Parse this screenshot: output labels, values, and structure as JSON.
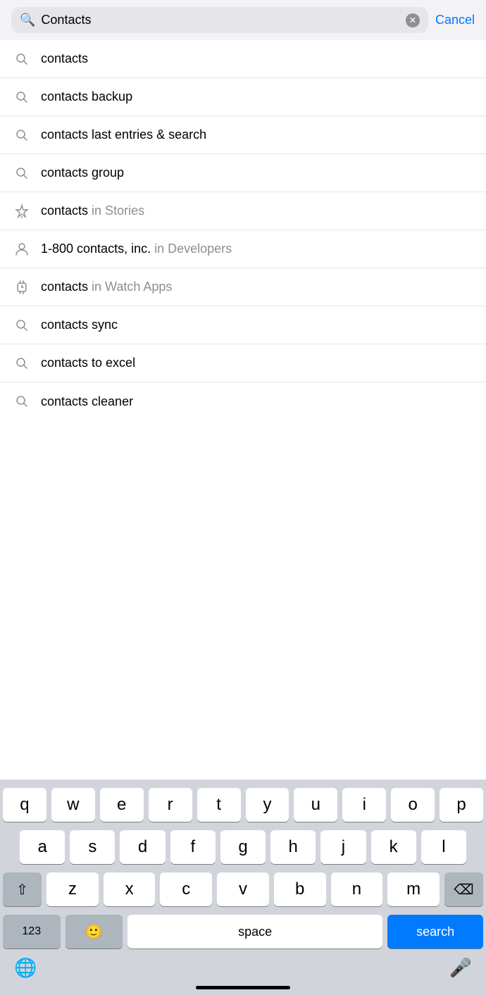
{
  "searchBar": {
    "inputValue": "Contacts",
    "cancelLabel": "Cancel"
  },
  "suggestions": [
    {
      "id": "contacts",
      "iconType": "search",
      "text": "contacts",
      "subText": ""
    },
    {
      "id": "contacts-backup",
      "iconType": "search",
      "text": "contacts backup",
      "subText": ""
    },
    {
      "id": "contacts-last-entries",
      "iconType": "search",
      "text": "contacts last entries & search",
      "subText": ""
    },
    {
      "id": "contacts-group",
      "iconType": "search",
      "text": "contacts group",
      "subText": ""
    },
    {
      "id": "contacts-in-stories",
      "iconType": "stories",
      "text": "contacts",
      "subText": " in Stories"
    },
    {
      "id": "1800-contacts",
      "iconType": "person",
      "text": "1-800 contacts, inc.",
      "subText": " in Developers"
    },
    {
      "id": "contacts-watch",
      "iconType": "watch",
      "text": "contacts",
      "subText": " in Watch Apps"
    },
    {
      "id": "contacts-sync",
      "iconType": "search",
      "text": "contacts sync",
      "subText": ""
    },
    {
      "id": "contacts-excel",
      "iconType": "search",
      "text": "contacts to excel",
      "subText": ""
    },
    {
      "id": "contacts-cleaner",
      "iconType": "search",
      "text": "contacts cleaner",
      "subText": ""
    }
  ],
  "keyboard": {
    "rows": [
      [
        "q",
        "w",
        "e",
        "r",
        "t",
        "y",
        "u",
        "i",
        "o",
        "p"
      ],
      [
        "a",
        "s",
        "d",
        "f",
        "g",
        "h",
        "j",
        "k",
        "l"
      ],
      [
        "z",
        "x",
        "c",
        "v",
        "b",
        "n",
        "m"
      ]
    ],
    "spaceLabel": "space",
    "searchLabel": "search",
    "numLabel": "123",
    "backspaceSymbol": "⌫"
  }
}
